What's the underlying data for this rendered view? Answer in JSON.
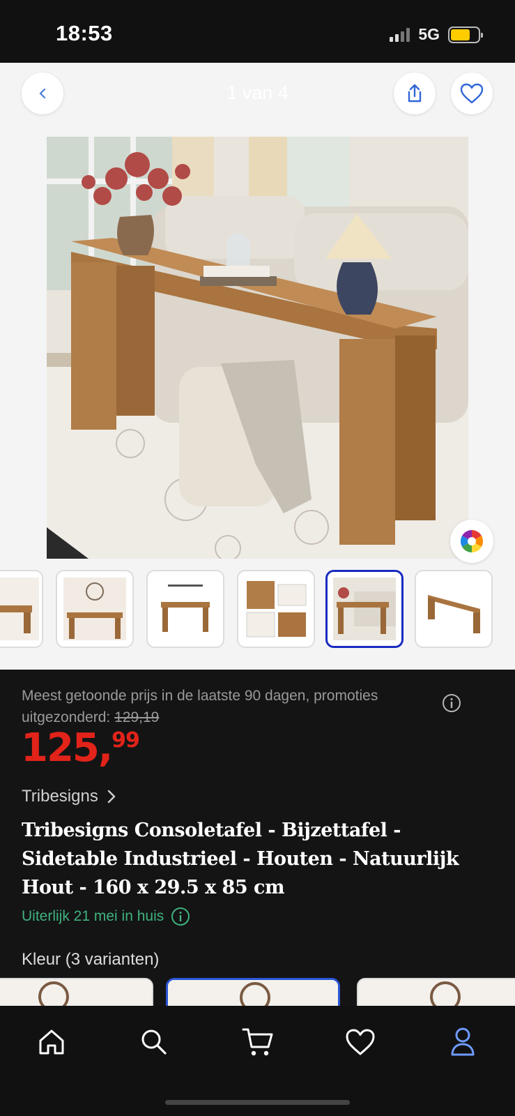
{
  "status_bar": {
    "time": "18:53",
    "network": "5G"
  },
  "gallery": {
    "counter": "1 van 4",
    "thumbnail_count": 6,
    "active_thumbnail": 5
  },
  "pricing": {
    "note_text": "Meest getoonde prijs in de laatste 90 dagen, promoties uitgezonderd:",
    "old_price": "129,19",
    "price_euros": "125,",
    "price_cents": "99",
    "price_color": "#e2231a"
  },
  "product": {
    "brand": "Tribesigns",
    "title": "Tribesigns Consoletafel - Bijzettafel - Sidetable Industrieel - Houten - Natuurlijk Hout - 160 x 29.5 x 85 cm",
    "delivery": "Uiterlijk 21 mei in huis",
    "delivery_color": "#3fb27f",
    "variants_label": "Kleur (3 varianten)"
  },
  "icons": {
    "back": "back-chevron-icon",
    "share": "share-icon",
    "favorite": "heart-icon",
    "color_wheel": "color-wheel-icon",
    "info": "info-icon",
    "brand_chevron": "chevron-right-icon"
  },
  "bottom_nav": {
    "items": [
      "home",
      "search",
      "cart",
      "favorites",
      "account"
    ],
    "active": "account",
    "active_color": "#6f9bff"
  }
}
